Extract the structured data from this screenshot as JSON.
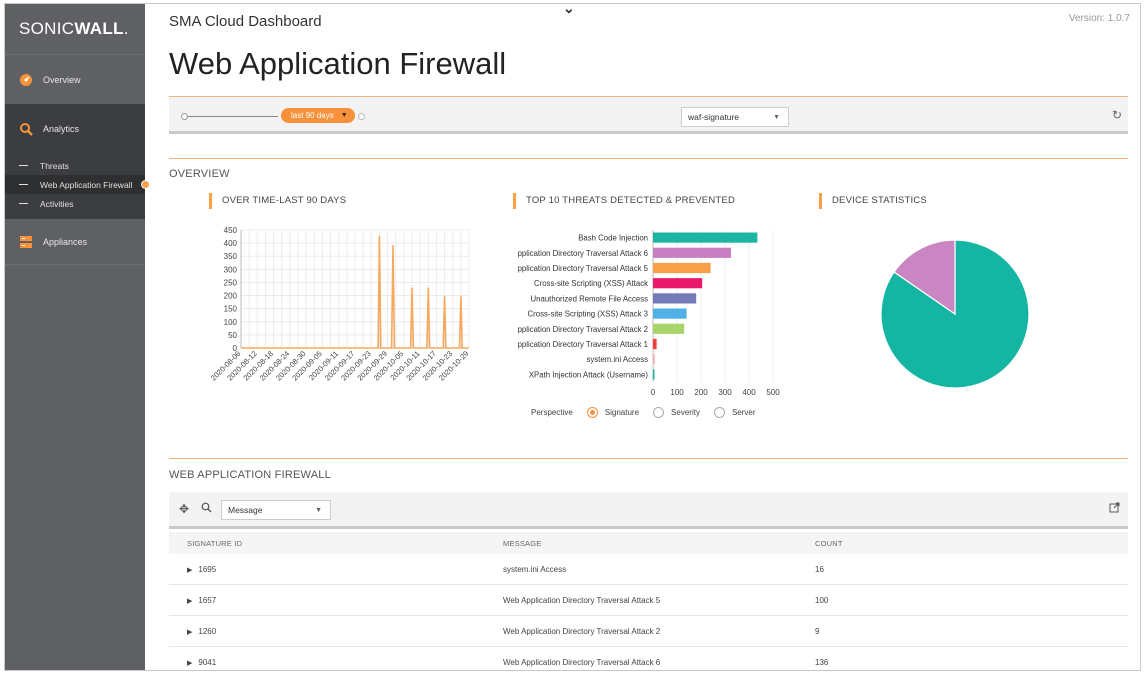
{
  "brand": {
    "logo_light": "SONIC",
    "logo_bold": "WALL",
    "logo_mark": "."
  },
  "sidebar": {
    "items": [
      {
        "label": "Overview",
        "icon": "dashboard-gauge-icon"
      },
      {
        "label": "Analytics",
        "icon": "analytics-magnifier-icon"
      },
      {
        "label": "Appliances",
        "icon": "appliances-icon"
      }
    ],
    "sub_items": [
      {
        "label": "Threats"
      },
      {
        "label": "Web Application Firewall",
        "active": true
      },
      {
        "label": "Activities"
      }
    ]
  },
  "header": {
    "breadcrumb": "SMA Cloud Dashboard",
    "version": "Version: 1.0.7",
    "title": "Web Application Firewall"
  },
  "filters": {
    "range_label": "last 90 days",
    "report_select": "waf-signature"
  },
  "overview": {
    "section_title": "OVERVIEW",
    "panel_over_time": "OVER TIME-LAST 90 DAYS",
    "panel_top10": "TOP 10 THREATS DETECTED & PREVENTED",
    "panel_device": "DEVICE STATISTICS",
    "perspective_label": "Perspective",
    "perspective_options": [
      "Signature",
      "Severity",
      "Server"
    ],
    "perspective_selected": "Signature"
  },
  "chart_data": [
    {
      "type": "line",
      "title": "OVER TIME-LAST 90 DAYS",
      "x": [
        "2020-08-06",
        "2020-08-12",
        "2020-08-18",
        "2020-08-24",
        "2020-08-30",
        "2020-09-05",
        "2020-09-11",
        "2020-09-17",
        "2020-09-23",
        "2020-09-29",
        "2020-10-05",
        "2020-10-11",
        "2020-10-17",
        "2020-10-23",
        "2020-10-29"
      ],
      "ylim": [
        0,
        450
      ],
      "yticks": [
        0,
        50,
        100,
        150,
        200,
        250,
        300,
        350,
        400,
        450
      ],
      "color": "#f5a85e",
      "spikes": [
        {
          "x": "2020-09-26",
          "y": 425
        },
        {
          "x": "2020-10-01",
          "y": 390
        },
        {
          "x": "2020-10-08",
          "y": 228
        },
        {
          "x": "2020-10-14",
          "y": 228
        },
        {
          "x": "2020-10-20",
          "y": 195
        },
        {
          "x": "2020-10-26",
          "y": 195
        }
      ],
      "grid": true
    },
    {
      "type": "bar",
      "title": "TOP 10 THREATS DETECTED & PREVENTED",
      "orientation": "horizontal",
      "categories": [
        "Bash Code Injection",
        "Web Application Directory Traversal Attack 6",
        "Web Application Directory Traversal Attack 5",
        "Cross-site Scripting (XSS) Attack",
        "Unauthorized Remote File Access",
        "Cross-site Scripting (XSS) Attack 3",
        "Web Application Directory Traversal Attack 2",
        "Web Application Directory Traversal Attack 1",
        "system.ini Access",
        "XPath Injection Attack (Username)"
      ],
      "tick_labels": [
        "Bash Code Injection",
        "pplication Directory Traversal Attack 6",
        "pplication Directory Traversal Attack 5",
        "Cross-site Scripting (XSS) Attack",
        "Unauthorized Remote File Access",
        "Cross-site Scripting (XSS) Attack 3",
        "pplication Directory Traversal Attack 2",
        "pplication Directory Traversal Attack 1",
        "system.ini Access",
        "XPath Injection Attack (Username)"
      ],
      "values": [
        435,
        325,
        240,
        205,
        180,
        140,
        130,
        15,
        8,
        5
      ],
      "colors": [
        "#1bb5a2",
        "#c77ec2",
        "#f7a048",
        "#e8196b",
        "#7479b8",
        "#4fb1e4",
        "#a8d46a",
        "#ee3a3a",
        "#f6b8b8",
        "#1bb5a2"
      ],
      "xlim": [
        0,
        500
      ],
      "xticks": [
        0,
        100,
        200,
        300,
        400,
        500
      ]
    },
    {
      "type": "pie",
      "title": "DEVICE STATISTICS",
      "values": [
        0.846,
        0.154
      ],
      "colors": [
        "#14b5a3",
        "#c986c2"
      ]
    }
  ],
  "table": {
    "section_title": "WEB APPLICATION FIREWALL",
    "filter_select": "Message",
    "columns": [
      "SIGNATURE ID",
      "MESSAGE",
      "COUNT"
    ],
    "rows": [
      {
        "id": "1695",
        "message": "system.ini Access",
        "count": "16"
      },
      {
        "id": "1657",
        "message": "Web Application Directory Traversal Attack 5",
        "count": "100"
      },
      {
        "id": "1260",
        "message": "Web Application Directory Traversal Attack 2",
        "count": "9"
      },
      {
        "id": "9041",
        "message": "Web Application Directory Traversal Attack 6",
        "count": "136"
      }
    ]
  }
}
